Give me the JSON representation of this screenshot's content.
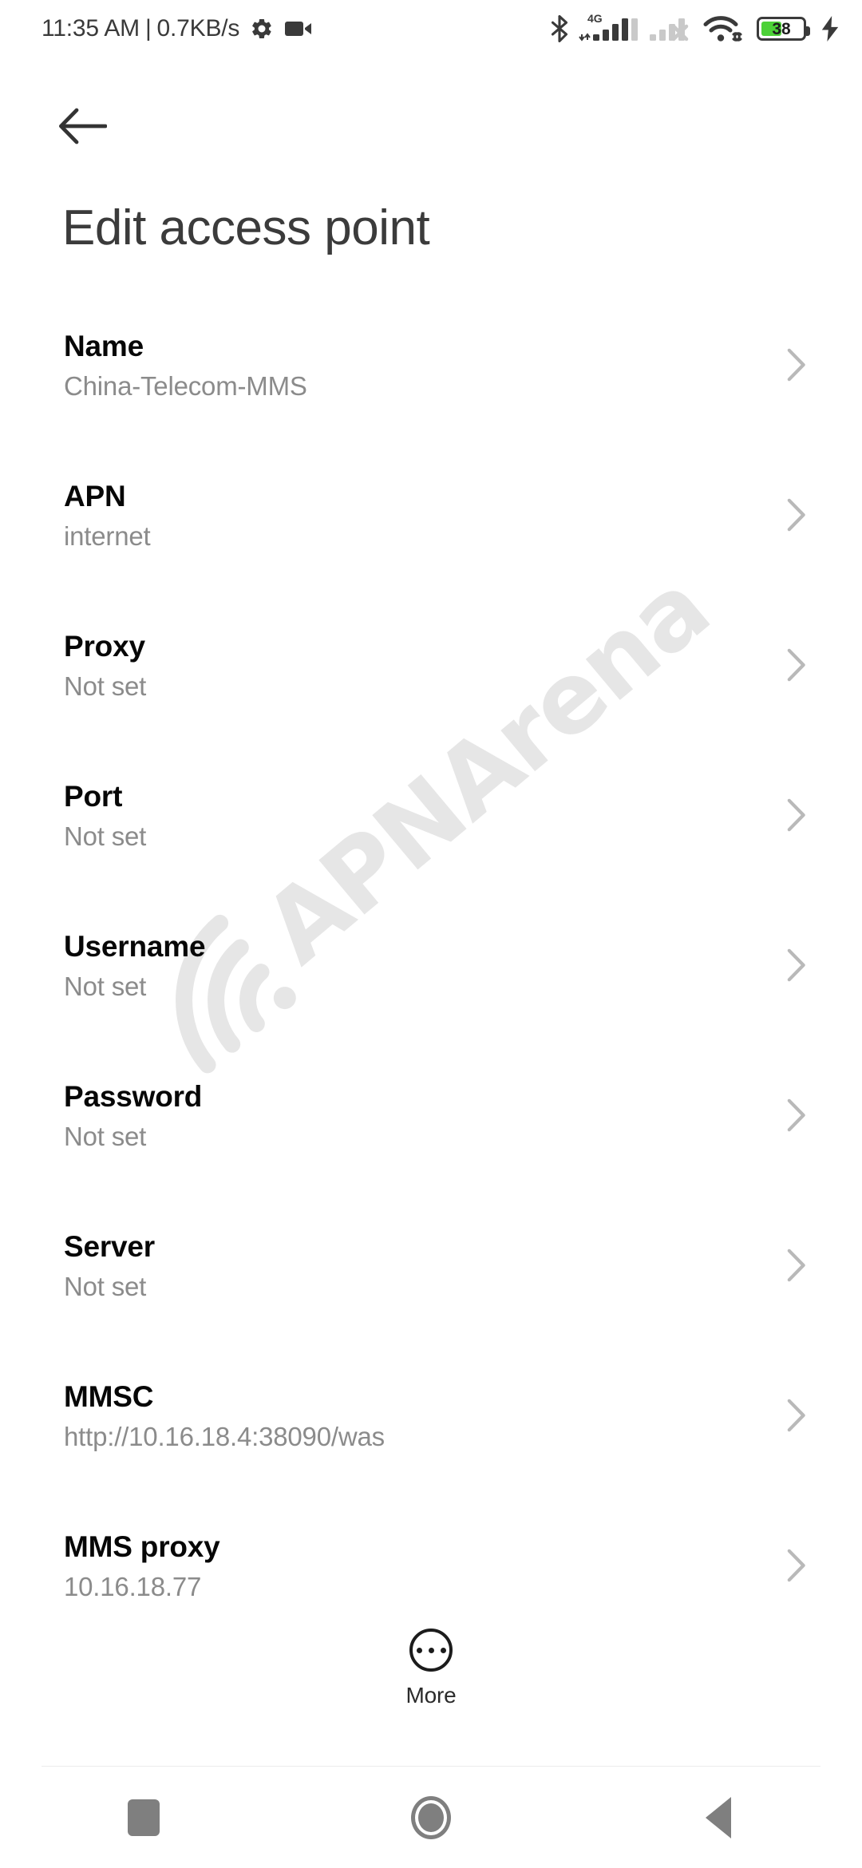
{
  "status_bar": {
    "time": "11:35 AM",
    "separator": "|",
    "network_speed": "0.7KB/s",
    "icons_left": [
      "gear-icon",
      "video-camera-icon"
    ],
    "icons_right": [
      "bluetooth-icon",
      "signal-4g-icon",
      "signal-sim2-no-service-icon",
      "wifi-icon",
      "battery-icon",
      "charging-bolt-icon"
    ],
    "network_type": "4G",
    "battery_level": "38",
    "battery_color": "#4cd137"
  },
  "header": {
    "back_label": "Back",
    "title": "Edit access point"
  },
  "watermark": {
    "text": "APNArena"
  },
  "list": {
    "rows": [
      {
        "title": "Name",
        "value": "China-Telecom-MMS"
      },
      {
        "title": "APN",
        "value": "internet"
      },
      {
        "title": "Proxy",
        "value": "Not set"
      },
      {
        "title": "Port",
        "value": "Not set"
      },
      {
        "title": "Username",
        "value": "Not set"
      },
      {
        "title": "Password",
        "value": "Not set"
      },
      {
        "title": "Server",
        "value": "Not set"
      },
      {
        "title": "MMSC",
        "value": "http://10.16.18.4:38090/was"
      },
      {
        "title": "MMS proxy",
        "value": "10.16.18.77"
      }
    ]
  },
  "more_button": {
    "label": "More"
  },
  "nav_bar": {
    "recents_label": "Recents",
    "home_label": "Home",
    "back_label": "Back"
  }
}
